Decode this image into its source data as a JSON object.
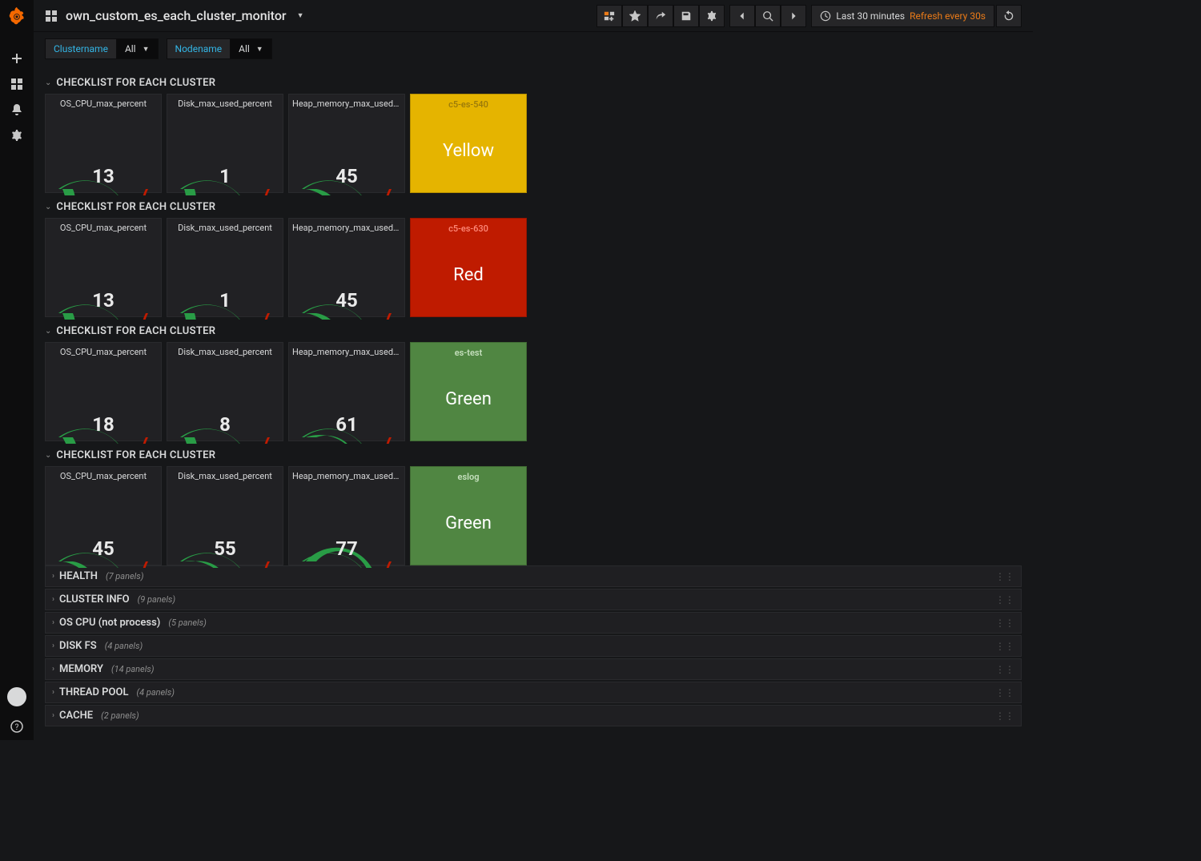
{
  "dashboard_title": "own_custom_es_each_cluster_monitor",
  "time_picker": {
    "range": "Last 30 minutes",
    "refresh": "Refresh every 30s"
  },
  "variables": [
    {
      "label": "Clustername",
      "value": "All"
    },
    {
      "label": "Nodename",
      "value": "All"
    }
  ],
  "checklist_row_title": "CHECKLIST FOR EACH CLUSTER",
  "gauge_titles": {
    "cpu": "OS_CPU_max_percent",
    "disk": "Disk_max_used_percent",
    "heap": "Heap_memory_max_used_pe..."
  },
  "clusters": [
    {
      "name": "c5-es-540",
      "status_label": "Yellow",
      "status_class": "status-yellow",
      "cpu": 13,
      "disk": 1,
      "disk_fill": 10,
      "heap": 45
    },
    {
      "name": "c5-es-630",
      "status_label": "Red",
      "status_class": "status-red",
      "cpu": 13,
      "disk": 1,
      "disk_fill": 10,
      "heap": 45
    },
    {
      "name": "es-test",
      "status_label": "Green",
      "status_class": "status-green",
      "cpu": 18,
      "disk": 8,
      "disk_fill": 14,
      "heap": 61
    },
    {
      "name": "eslog",
      "status_label": "Green",
      "status_class": "status-green",
      "cpu": 45,
      "disk": 55,
      "disk_fill": 55,
      "heap": 77
    }
  ],
  "collapsed_rows": [
    {
      "title": "HEALTH",
      "count": "(7 panels)"
    },
    {
      "title": "CLUSTER INFO",
      "count": "(9 panels)"
    },
    {
      "title": "OS CPU (not process)",
      "count": "(5 panels)"
    },
    {
      "title": "DISK FS",
      "count": "(4 panels)"
    },
    {
      "title": "MEMORY",
      "count": "(14 panels)"
    },
    {
      "title": "THREAD POOL",
      "count": "(4 panels)"
    },
    {
      "title": "CACHE",
      "count": "(2 panels)"
    }
  ],
  "chart_data": [
    {
      "type": "gauge",
      "cluster": "c5-es-540",
      "metric": "OS_CPU_max_percent",
      "value": 13,
      "range": [
        0,
        100
      ]
    },
    {
      "type": "gauge",
      "cluster": "c5-es-540",
      "metric": "Disk_max_used_percent",
      "value": 1,
      "range": [
        0,
        100
      ]
    },
    {
      "type": "gauge",
      "cluster": "c5-es-540",
      "metric": "Heap_memory_max_used_percent",
      "value": 45,
      "range": [
        0,
        100
      ]
    },
    {
      "type": "status",
      "cluster": "c5-es-540",
      "state": "Yellow"
    },
    {
      "type": "gauge",
      "cluster": "c5-es-630",
      "metric": "OS_CPU_max_percent",
      "value": 13,
      "range": [
        0,
        100
      ]
    },
    {
      "type": "gauge",
      "cluster": "c5-es-630",
      "metric": "Disk_max_used_percent",
      "value": 1,
      "range": [
        0,
        100
      ]
    },
    {
      "type": "gauge",
      "cluster": "c5-es-630",
      "metric": "Heap_memory_max_used_percent",
      "value": 45,
      "range": [
        0,
        100
      ]
    },
    {
      "type": "status",
      "cluster": "c5-es-630",
      "state": "Red"
    },
    {
      "type": "gauge",
      "cluster": "es-test",
      "metric": "OS_CPU_max_percent",
      "value": 18,
      "range": [
        0,
        100
      ]
    },
    {
      "type": "gauge",
      "cluster": "es-test",
      "metric": "Disk_max_used_percent",
      "value": 8,
      "range": [
        0,
        100
      ]
    },
    {
      "type": "gauge",
      "cluster": "es-test",
      "metric": "Heap_memory_max_used_percent",
      "value": 61,
      "range": [
        0,
        100
      ]
    },
    {
      "type": "status",
      "cluster": "es-test",
      "state": "Green"
    },
    {
      "type": "gauge",
      "cluster": "eslog",
      "metric": "OS_CPU_max_percent",
      "value": 45,
      "range": [
        0,
        100
      ]
    },
    {
      "type": "gauge",
      "cluster": "eslog",
      "metric": "Disk_max_used_percent",
      "value": 55,
      "range": [
        0,
        100
      ]
    },
    {
      "type": "gauge",
      "cluster": "eslog",
      "metric": "Heap_memory_max_used_percent",
      "value": 77,
      "range": [
        0,
        100
      ]
    },
    {
      "type": "status",
      "cluster": "eslog",
      "state": "Green"
    }
  ]
}
